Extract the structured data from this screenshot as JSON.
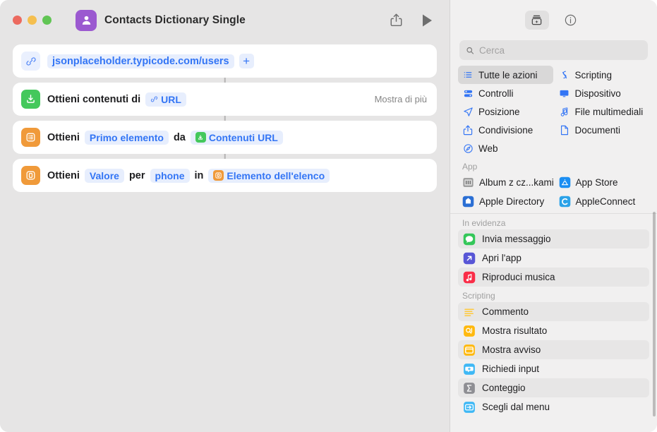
{
  "window": {
    "title": "Contacts Dictionary Single",
    "app_icon": "contacts-person-icon",
    "traffic_lights": [
      "close-red",
      "minimize-yellow",
      "zoom-green"
    ],
    "share_icon": "share-icon",
    "run_icon": "play-icon"
  },
  "editor": {
    "actions": [
      {
        "id": "url-action",
        "icon": "link-icon",
        "icon_style": "url-chip",
        "value": "jsonplaceholder.typicode.com/users",
        "add_label": "+"
      },
      {
        "id": "get-contents-of-url",
        "icon": "download-box-icon",
        "icon_style": "green",
        "prefix": "Ottieni contenuti di",
        "token_icon": "link-icon",
        "token": "URL",
        "show_more": "Mostra di più"
      },
      {
        "id": "get-item-from-list",
        "icon": "list-bullets-icon",
        "icon_style": "orange",
        "prefix": "Ottieni",
        "token1": "Primo elemento",
        "middle": "da",
        "var_icon": "download-box-icon",
        "var_label": "Contenuti URL"
      },
      {
        "id": "get-dictionary-value",
        "icon": "dictionary-icon",
        "icon_style": "orange",
        "prefix": "Ottieni",
        "token1": "Valore",
        "middle1": "per",
        "token2": "phone",
        "middle2": "in",
        "var_icon": "dictionary-icon",
        "var_label": "Elemento dell'elenco"
      }
    ]
  },
  "sidebar": {
    "toolbar": {
      "library_button": "action-library-icon",
      "info_button": "info-circle-icon"
    },
    "search": {
      "placeholder": "Cerca",
      "value": "",
      "icon": "search-icon"
    },
    "categories": [
      {
        "label": "Tutte le azioni",
        "icon": "list-icon",
        "selected": true
      },
      {
        "label": "Scripting",
        "icon": "scripting-icon",
        "selected": false
      },
      {
        "label": "Controlli",
        "icon": "controls-icon",
        "selected": false
      },
      {
        "label": "Dispositivo",
        "icon": "display-icon",
        "selected": false
      },
      {
        "label": "Posizione",
        "icon": "location-arrow-icon",
        "selected": false
      },
      {
        "label": "File multimediali",
        "icon": "music-note-icon",
        "selected": false
      },
      {
        "label": "Condivisione",
        "icon": "share-icon",
        "selected": false
      },
      {
        "label": "Documenti",
        "icon": "document-icon",
        "selected": false
      },
      {
        "label": "Web",
        "icon": "safari-compass-icon",
        "selected": false
      }
    ],
    "app_section": {
      "header": "App",
      "items": [
        {
          "label": "Album z cz...kami",
          "icon": "photos-album-icon"
        },
        {
          "label": "App Store",
          "icon": "app-store-icon"
        },
        {
          "label": "Apple Directory",
          "icon": "apple-directory-icon"
        },
        {
          "label": "AppleConnect",
          "icon": "appleconnect-icon"
        }
      ]
    },
    "featured_section": {
      "header": "In evidenza",
      "items": [
        {
          "label": "Invia messaggio",
          "icon": "messages-icon",
          "color": "#34c759"
        },
        {
          "label": "Apri l'app",
          "icon": "open-app-icon",
          "color": "#5856d6"
        },
        {
          "label": "Riproduci musica",
          "icon": "music-icon",
          "color": "#fa2d48"
        }
      ]
    },
    "scripting_section": {
      "header": "Scripting",
      "items": [
        {
          "label": "Commento",
          "icon": "comment-lines-icon",
          "color": "#ffffff"
        },
        {
          "label": "Mostra risultato",
          "icon": "show-result-icon",
          "color": "#ffb90f"
        },
        {
          "label": "Mostra avviso",
          "icon": "show-alert-icon",
          "color": "#ffb90f"
        },
        {
          "label": "Richiedi input",
          "icon": "ask-input-icon",
          "color": "#3fb8f5"
        },
        {
          "label": "Conteggio",
          "icon": "count-sigma-icon",
          "color": "#8e8e93"
        },
        {
          "label": "Scegli dal menu",
          "icon": "choose-menu-icon",
          "color": "#3fb8f5"
        }
      ]
    }
  },
  "colors": {
    "accent_blue": "#3375f5",
    "token_bg": "#e7eefd",
    "canvas": "#e6e5e5",
    "sidebar": "#f1f0f0",
    "green_action": "#44c85c",
    "orange_action": "#f09a3a"
  }
}
